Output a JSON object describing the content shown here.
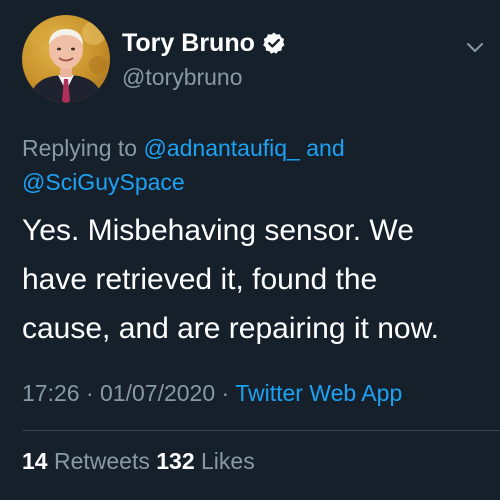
{
  "author": {
    "display_name": "Tory Bruno",
    "handle": "@torybruno",
    "verified": true
  },
  "reply": {
    "prefix": "Replying to",
    "mention_1": "@adnantaufiq_",
    "conjunction": "and",
    "mention_2": "@SciGuySpace"
  },
  "tweet": {
    "lines": [
      "Yes.  Misbehaving sensor.  We",
      "have retrieved it, found the",
      "cause, and are repairing it now."
    ]
  },
  "meta": {
    "time": "17:26",
    "separator_1": "·",
    "date": "01/07/2020",
    "separator_2": "·",
    "source": "Twitter Web App"
  },
  "stats": {
    "retweets_count": "14",
    "retweets_label": "Retweets",
    "likes_count": "132",
    "likes_label": "Likes"
  },
  "colors": {
    "background": "#15202b",
    "text_primary": "#ffffff",
    "text_secondary": "#8899a6",
    "link": "#1da1f2",
    "divider": "#38444d"
  },
  "icons": {
    "verified": "verified-badge-icon",
    "menu": "chevron-down-icon"
  }
}
